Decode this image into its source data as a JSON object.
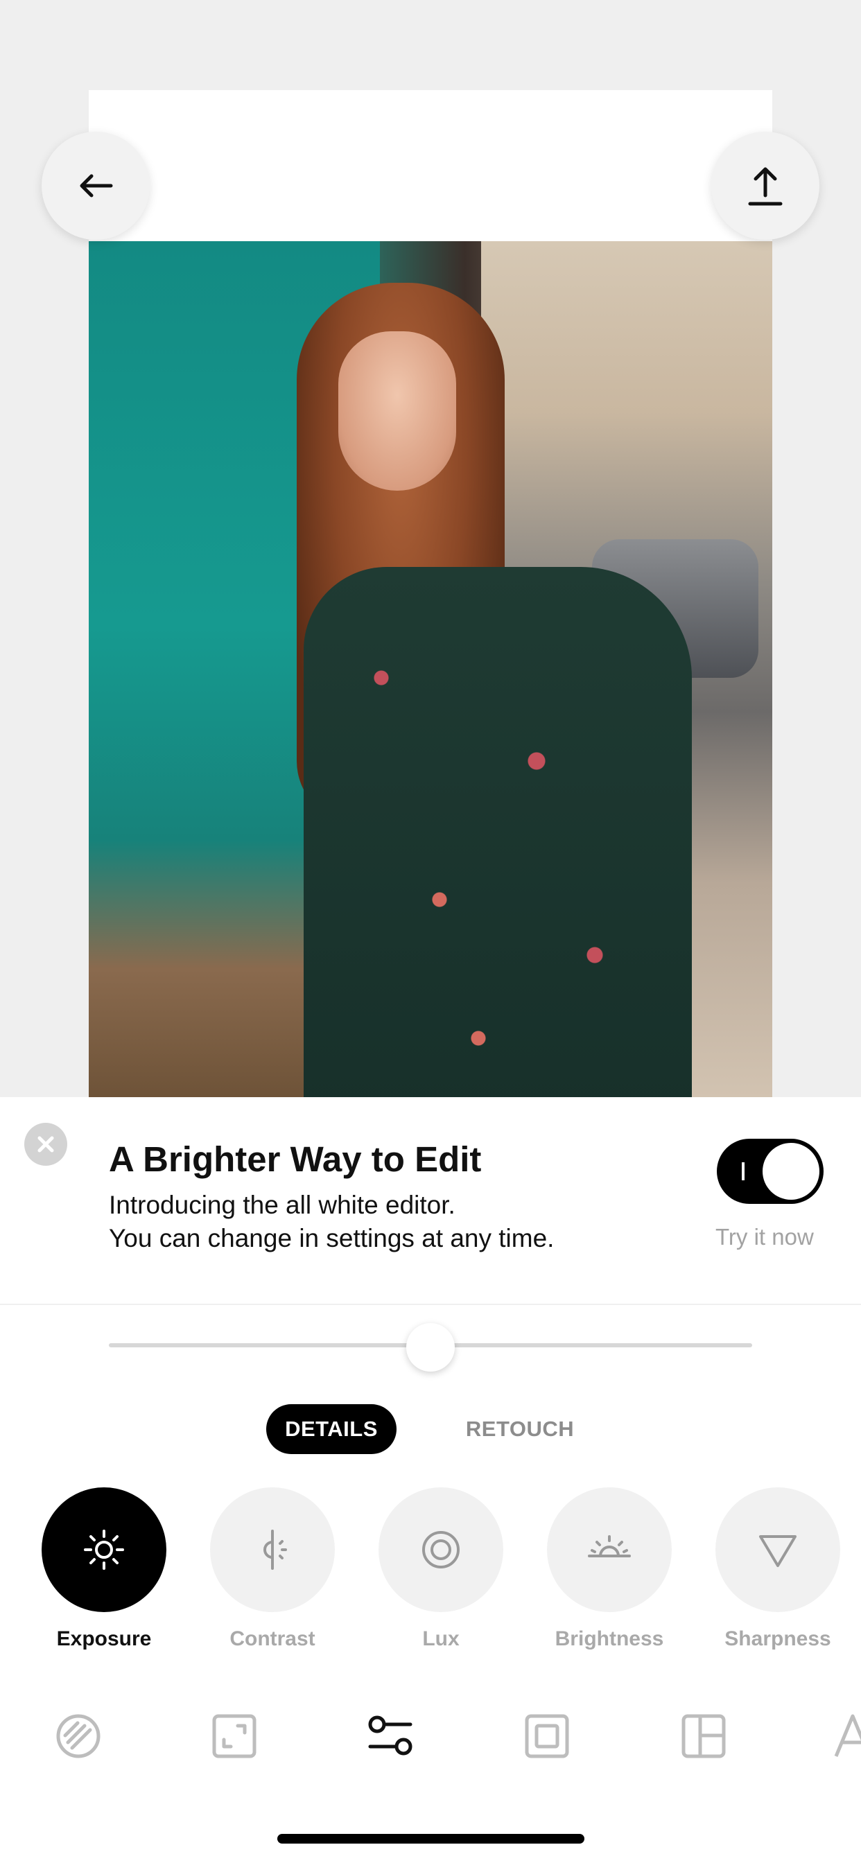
{
  "banner": {
    "title": "A Brighter Way to Edit",
    "line1": "Introducing the all white editor.",
    "line2": "You can change in settings at any time.",
    "toggle_state": "on",
    "toggle_label": "Try it now"
  },
  "slider": {
    "value": 0.5
  },
  "tabs": [
    {
      "label": "DETAILS",
      "active": true
    },
    {
      "label": "RETOUCH",
      "active": false
    }
  ],
  "tools": [
    {
      "label": "Exposure",
      "icon": "sun-icon",
      "active": true
    },
    {
      "label": "Contrast",
      "icon": "contrast-icon",
      "active": false
    },
    {
      "label": "Lux",
      "icon": "lux-icon",
      "active": false
    },
    {
      "label": "Brightness",
      "icon": "sunrise-icon",
      "active": false
    },
    {
      "label": "Sharpness",
      "icon": "triangle-icon",
      "active": false
    }
  ],
  "nav_icons": [
    "filter-icon",
    "crop-icon",
    "adjust-icon",
    "frame-icon",
    "layout-icon",
    "text-icon"
  ],
  "colors": {
    "accent": "#000000",
    "inactive": "#a9a9a9",
    "sheet": "#ffffff"
  }
}
